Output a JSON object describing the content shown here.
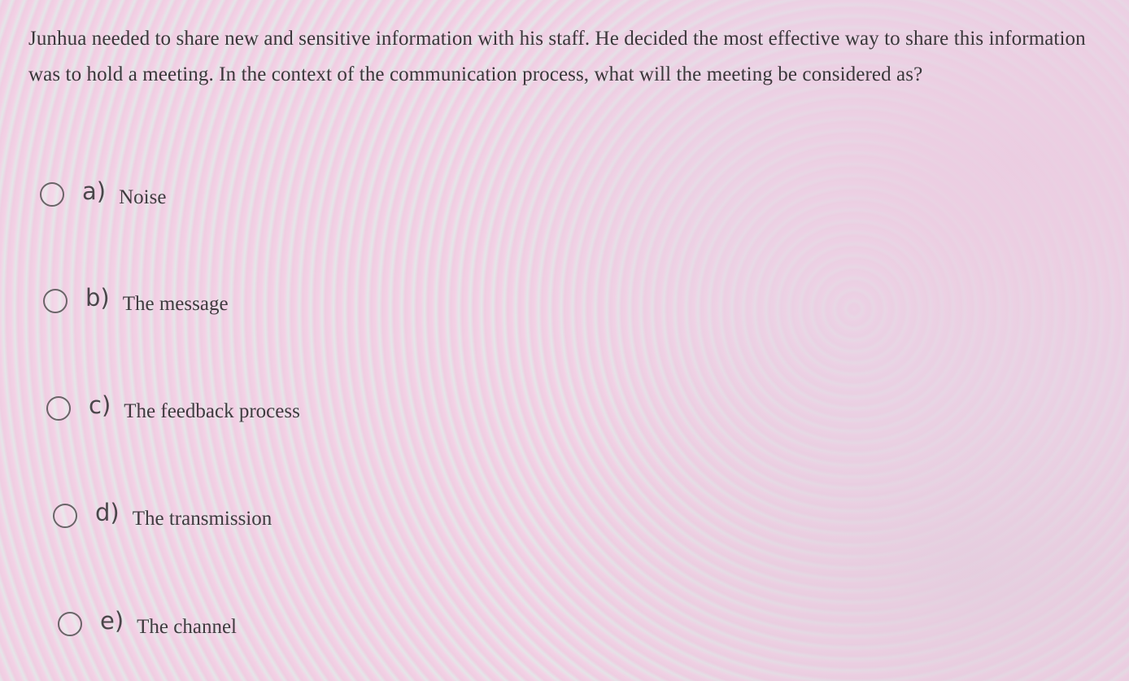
{
  "question": {
    "text": "Junhua needed to share new and sensitive information with his staff. He decided the most effective way to share this information was to hold a meeting. In the context of the communication process, what will the meeting be considered as?"
  },
  "options": [
    {
      "letter": "a)",
      "label": "Noise",
      "selected": false
    },
    {
      "letter": "b)",
      "label": "The message",
      "selected": false
    },
    {
      "letter": "c)",
      "label": "The feedback process",
      "selected": false
    },
    {
      "letter": "d)",
      "label": "The transmission",
      "selected": false
    },
    {
      "letter": "e)",
      "label": "The channel",
      "selected": false
    }
  ]
}
